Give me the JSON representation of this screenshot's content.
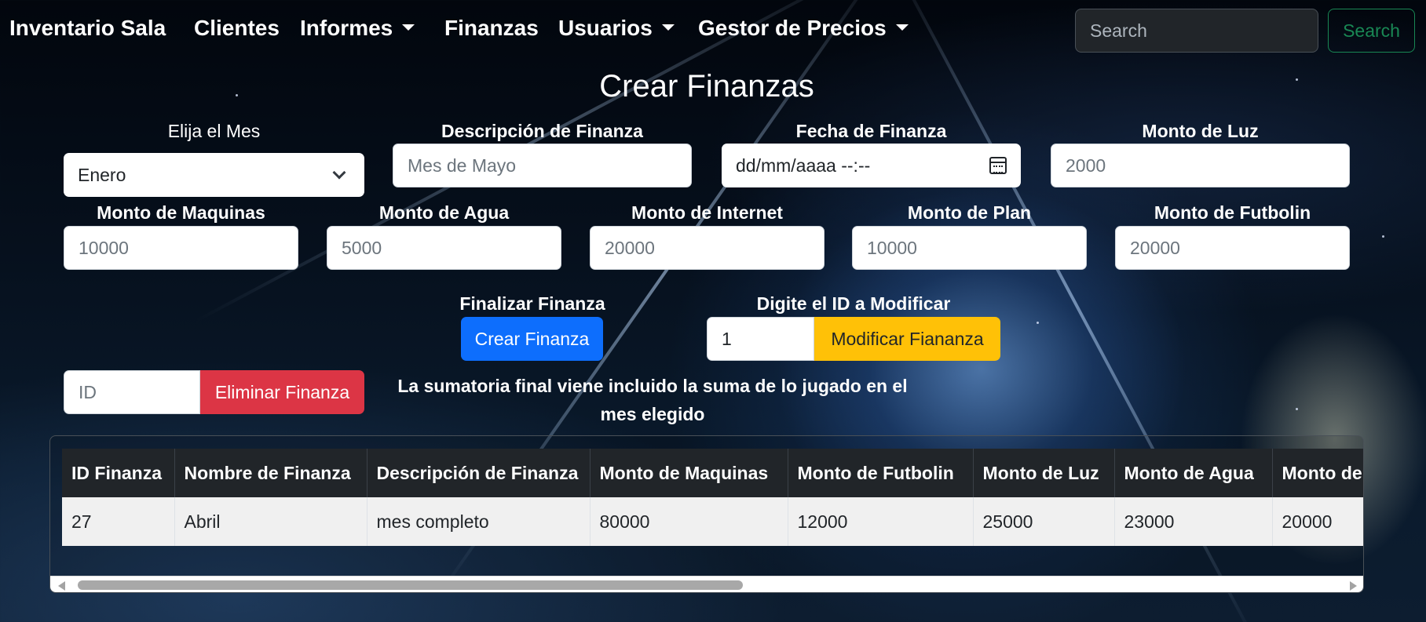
{
  "navbar": {
    "brand": "Inventario Sala",
    "items": [
      {
        "label": "Clientes",
        "dropdown": false
      },
      {
        "label": "Informes",
        "dropdown": true
      },
      {
        "label": "Finanzas",
        "dropdown": false
      },
      {
        "label": "Usuarios",
        "dropdown": true
      },
      {
        "label": "Gestor de Precios",
        "dropdown": true
      }
    ],
    "search_placeholder": "Search",
    "search_button": "Search"
  },
  "form": {
    "title": "Crear Finanzas",
    "mes_label": "Elija el Mes",
    "mes_value": "Enero",
    "descripcion_label": "Descripción de Finanza",
    "descripcion_placeholder": "Mes de Mayo",
    "fecha_label": "Fecha de Finanza",
    "fecha_placeholder": "dd/mm/aaaa --:--",
    "luz_label": "Monto de Luz",
    "luz_placeholder": "2000",
    "maquinas_label": "Monto de Maquinas",
    "maquinas_placeholder": "10000",
    "agua_label": "Monto de Agua",
    "agua_placeholder": "5000",
    "internet_label": "Monto de Internet",
    "internet_placeholder": "20000",
    "plan_label": "Monto de Plan",
    "plan_placeholder": "10000",
    "futbolin_label": "Monto de Futbolin",
    "futbolin_placeholder": "20000",
    "finalizar_label": "Finalizar Finanza",
    "crear_button": "Crear Finanza",
    "modificar_label": "Digite el ID a Modificar",
    "modificar_value": "1",
    "modificar_button": "Modificar Fiananza",
    "eliminar_placeholder": "ID",
    "eliminar_button": "Eliminar Finanza",
    "note": "La sumatoria final viene incluido la suma de lo jugado en el mes elegido"
  },
  "table": {
    "headers": [
      "ID Finanza",
      "Nombre de Finanza",
      "Descripción de Finanza",
      "Monto de Maquinas",
      "Monto de Futbolin",
      "Monto de Luz",
      "Monto de Agua",
      "Monto de"
    ],
    "rows": [
      [
        "27",
        "Abril",
        "mes completo",
        "80000",
        "12000",
        "25000",
        "23000",
        "20000"
      ]
    ]
  },
  "colors": {
    "primary": "#0d6efd",
    "warning": "#ffc107",
    "danger": "#dc3545",
    "success": "#198754",
    "dark": "#212529"
  }
}
